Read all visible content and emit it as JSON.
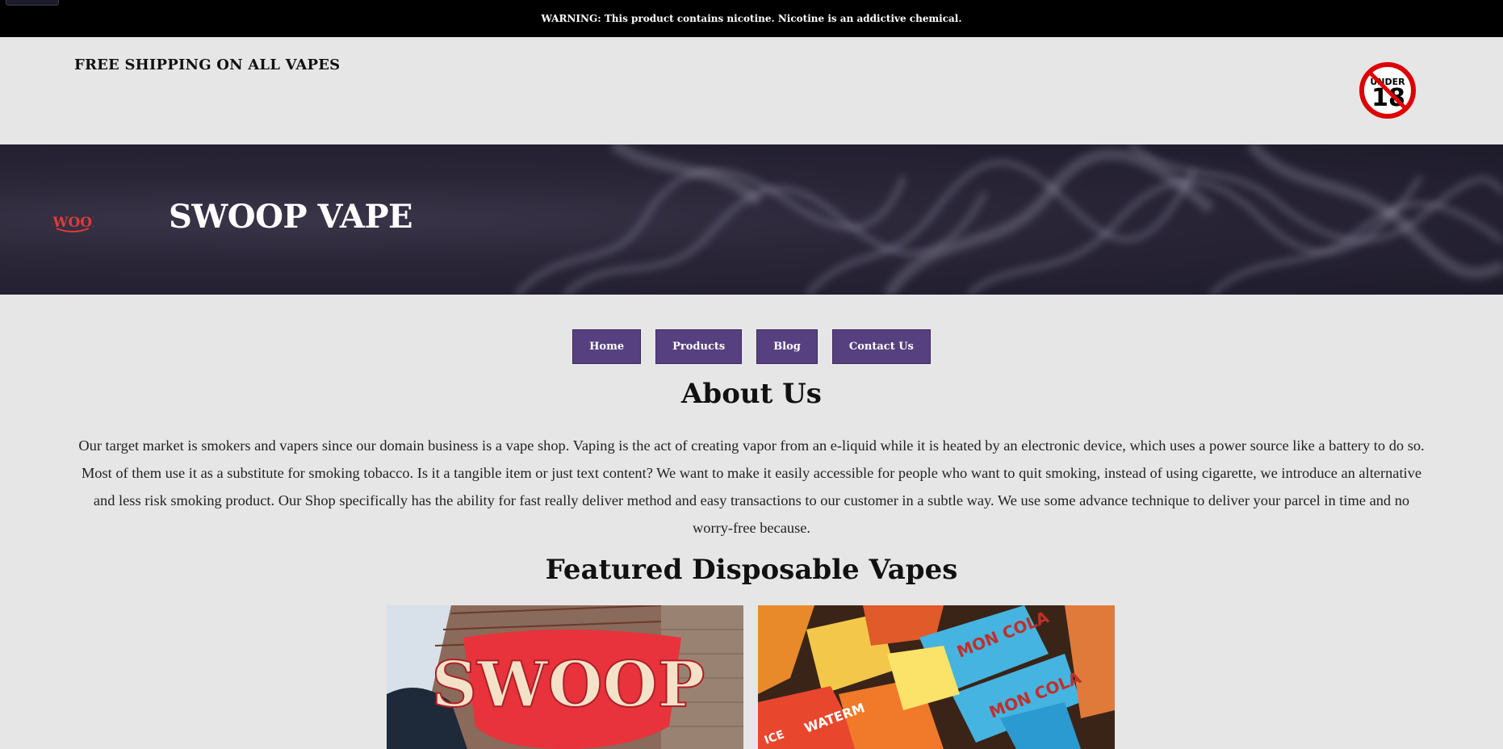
{
  "warning": {
    "text": "WARNING: This product contains nicotine. Nicotine is an addictive chemical."
  },
  "topbar": {
    "free_shipping": "FREE SHIPPING ON ALL VAPES",
    "age_badge": {
      "top": "UNDER",
      "number": "18"
    }
  },
  "hero": {
    "logo_text": "SWOOP",
    "title": "SWOOP VAPE"
  },
  "nav": {
    "items": [
      {
        "label": "Home"
      },
      {
        "label": "Products"
      },
      {
        "label": "Blog"
      },
      {
        "label": "Contact Us"
      }
    ],
    "color": "#57407f"
  },
  "about": {
    "title": "About Us",
    "body": "Our target market is smokers and vapers since our domain business is a vape shop. Vaping is the act of creating vapor from an e-liquid while it is heated by an electronic device, which uses a power source like a battery to do so. Most of them use it as a substitute for smoking tobacco. Is it a tangible item or just text content? We want to make it easily accessible for people who want to quit smoking, instead of using cigarette, we introduce an alternative and less risk smoking product. Our Shop specifically has the ability for fast really deliver method and easy transactions to our customer in a subtle way. We use some advance technique to deliver your parcel in time and no worry-free because."
  },
  "featured": {
    "title": "Featured Disposable Vapes",
    "images": [
      {
        "sign_text": "SWOOP"
      },
      {
        "labels": [
          "MON COLA",
          "MON COLA",
          "WATERM",
          "ICE"
        ]
      }
    ]
  },
  "colors": {
    "warning_bg": "#000000",
    "page_bg": "#e6e6e6",
    "hero_bg": "#2a2638",
    "logo_red": "#e03a3a"
  }
}
